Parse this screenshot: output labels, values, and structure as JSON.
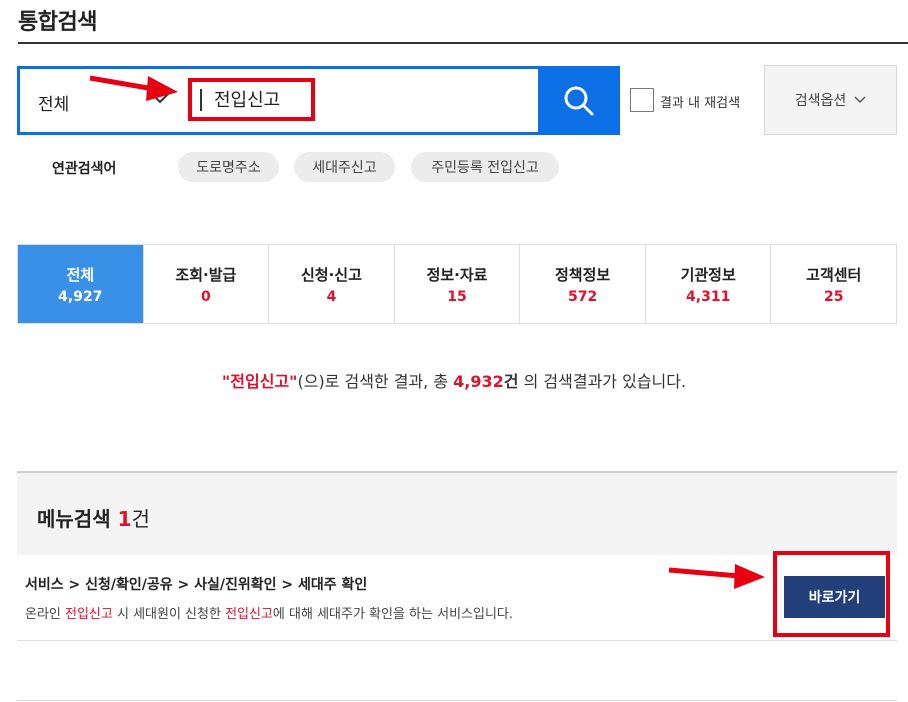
{
  "header": {
    "title": "통합검색"
  },
  "search": {
    "scope": "전체",
    "query": "전입신고",
    "button_icon": "search-icon"
  },
  "within_results": {
    "label": "결과 내 재검색",
    "checked": false
  },
  "options": {
    "label": "검색옵션"
  },
  "related": {
    "label": "연관검색어",
    "terms": [
      "도로명주소",
      "세대주신고",
      "주민등록 전입신고"
    ]
  },
  "tabs": [
    {
      "label": "전체",
      "count": "4,927",
      "active": true
    },
    {
      "label": "조회·발급",
      "count": "0",
      "active": false
    },
    {
      "label": "신청·신고",
      "count": "4",
      "active": false
    },
    {
      "label": "정보·자료",
      "count": "15",
      "active": false
    },
    {
      "label": "정책정보",
      "count": "572",
      "active": false
    },
    {
      "label": "기관정보",
      "count": "4,311",
      "active": false
    },
    {
      "label": "고객센터",
      "count": "25",
      "active": false
    }
  ],
  "summary": {
    "quoted_query": "\"전입신고\"",
    "part1": "(으)로 검색한 결과, 총 ",
    "total": "4,932",
    "unit": "건",
    "part2": " 의 검색결과가 있습니다."
  },
  "menu_search": {
    "title": "메뉴검색",
    "count": "1",
    "unit": "건"
  },
  "result": {
    "path": "서비스 > 신청/확인/공유 > 사실/진위확인 > 세대주 확인",
    "desc_1": "온라인 ",
    "desc_hl_1": "전입신고",
    "desc_2": " 시 세대원이 신청한 ",
    "desc_hl_2": "전입신고",
    "desc_3": "에 대해 세대주가 확인을 하는 서비스입니다.",
    "go_label": "바로가기"
  },
  "colors": {
    "accent_blue": "#0b6fe5",
    "active_tab": "#3a8fe6",
    "highlight_red": "#e0112b",
    "go_button": "#233f7a",
    "annotation_red": "#e60012"
  }
}
